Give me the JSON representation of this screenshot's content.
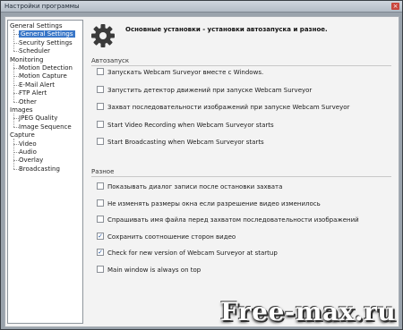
{
  "window": {
    "title": "Настройки программы",
    "close_icon": "close-icon"
  },
  "tree": {
    "items": [
      {
        "label": "General Settings",
        "level": 0
      },
      {
        "label": "General Settings",
        "level": 1,
        "selected": true
      },
      {
        "label": "Security Settings",
        "level": 1
      },
      {
        "label": "Scheduler",
        "level": 1
      },
      {
        "label": "Monitoring",
        "level": 0
      },
      {
        "label": "Motion Detection",
        "level": 1
      },
      {
        "label": "Motion Capture",
        "level": 1
      },
      {
        "label": "E-Mail Alert",
        "level": 1
      },
      {
        "label": "FTP Alert",
        "level": 1
      },
      {
        "label": "Other",
        "level": 1
      },
      {
        "label": "Images",
        "level": 0
      },
      {
        "label": "JPEG Quality",
        "level": 1
      },
      {
        "label": "Image Sequence",
        "level": 1
      },
      {
        "label": "Capture",
        "level": 0
      },
      {
        "label": "Video",
        "level": 1
      },
      {
        "label": "Audio",
        "level": 1
      },
      {
        "label": "Overlay",
        "level": 1
      },
      {
        "label": "Broadcasting",
        "level": 1
      }
    ]
  },
  "content": {
    "heading": "Основные установки - установки автозапуска и разное.",
    "icon": "gear-icon",
    "autostart_group": "Автозапуск",
    "autostart_options": [
      {
        "label": "Запускать Webcam Surveyor вместе с Windows.",
        "checked": false
      },
      {
        "label": "Запустить детектор движений при запуске Webcam Surveyor",
        "checked": false
      },
      {
        "label": "Захват последовательности изображений при запуске Webcam Surveyor",
        "checked": false
      },
      {
        "label": "Start Video Recording when Webcam Surveyor starts",
        "checked": false
      },
      {
        "label": "Start Broadcasting when Webcam Surveyor starts",
        "checked": false
      }
    ],
    "misc_group": "Разное",
    "misc_options": [
      {
        "label": "Показывать диалог записи после остановки захвата",
        "checked": false
      },
      {
        "label": "Не изменять размеры окна если разрешение видео изменилось",
        "checked": false
      },
      {
        "label": "Спрашивать имя файла перед захватом последовательности изображений",
        "checked": false
      },
      {
        "label": "Сохранить соотношение сторон видео",
        "checked": true
      },
      {
        "label": "Check for new version of Webcam Surveyor at startup",
        "checked": true
      },
      {
        "label": "Main window is always on top",
        "checked": false
      }
    ]
  },
  "watermark": "Free-max.ru"
}
